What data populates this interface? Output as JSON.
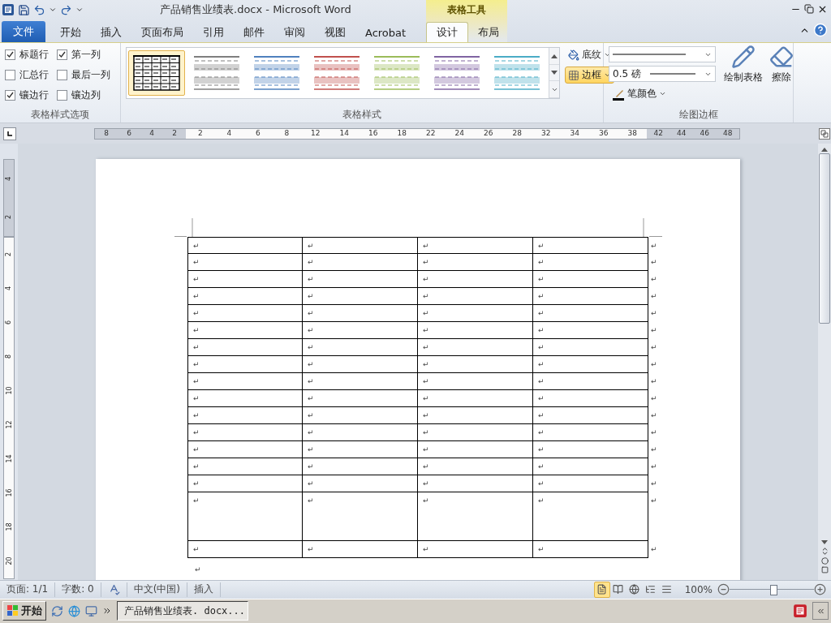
{
  "title_bar": {
    "title": "产品销售业绩表.docx  -  Microsoft Word"
  },
  "tabs": [
    {
      "label": "文件",
      "kind": "file",
      "selected": false
    },
    {
      "label": "开始",
      "kind": "plain",
      "selected": false
    },
    {
      "label": "插入",
      "kind": "plain",
      "selected": false
    },
    {
      "label": "页面布局",
      "kind": "plain",
      "selected": false
    },
    {
      "label": "引用",
      "kind": "plain",
      "selected": false
    },
    {
      "label": "邮件",
      "kind": "plain",
      "selected": false
    },
    {
      "label": "审阅",
      "kind": "plain",
      "selected": false
    },
    {
      "label": "视图",
      "kind": "plain",
      "selected": false
    },
    {
      "label": "Acrobat",
      "kind": "plain",
      "selected": false
    }
  ],
  "contextual_group": {
    "label": "表格工具",
    "tabs": [
      {
        "label": "设计",
        "selected": true
      },
      {
        "label": "布局",
        "selected": false
      }
    ]
  },
  "ribbon": {
    "style_options": {
      "label": "表格样式选项",
      "options": [
        {
          "label": "标题行",
          "checked": true
        },
        {
          "label": "第一列",
          "checked": true
        },
        {
          "label": "汇总行",
          "checked": false
        },
        {
          "label": "最后一列",
          "checked": false
        },
        {
          "label": "镶边行",
          "checked": true
        },
        {
          "label": "镶边列",
          "checked": false
        }
      ]
    },
    "table_styles": {
      "label": "表格样式",
      "styles": [
        {
          "kind": "grid",
          "color": "#000000",
          "selected": true
        },
        {
          "kind": "banded",
          "color": "#7f7f7f",
          "selected": false
        },
        {
          "kind": "banded",
          "color": "#4f81bd",
          "selected": false
        },
        {
          "kind": "banded",
          "color": "#c0504d",
          "selected": false
        },
        {
          "kind": "banded",
          "color": "#9bbb59",
          "selected": false
        },
        {
          "kind": "banded",
          "color": "#8064a2",
          "selected": false
        },
        {
          "kind": "banded",
          "color": "#4bacc6",
          "selected": false
        }
      ],
      "shading": "底纹",
      "borders": {
        "label": "边框",
        "selected": true
      }
    },
    "draw_borders": {
      "label": "绘图边框",
      "line_weight": "0.5 磅",
      "pen_color": "笔颜色",
      "draw_table": "绘制表格",
      "eraser": "擦除"
    }
  },
  "horizontal_ruler": [
    {
      "kind": "margin",
      "labels": [
        "8",
        "6",
        "4",
        "2"
      ]
    },
    {
      "kind": "column",
      "labels": [
        "2",
        "4",
        "6",
        "8"
      ]
    },
    {
      "kind": "column",
      "labels": [
        "12",
        "14",
        "16",
        "18"
      ]
    },
    {
      "kind": "column",
      "labels": [
        "22",
        "24",
        "26",
        "28"
      ]
    },
    {
      "kind": "column",
      "labels": [
        "32",
        "34",
        "36",
        "38"
      ]
    },
    {
      "kind": "margin",
      "labels": [
        "42",
        "44",
        "46",
        "48"
      ]
    }
  ],
  "vertical_ruler": [
    {
      "kind": "margin",
      "labels": [
        "4",
        "2"
      ]
    },
    {
      "kind": "column",
      "labels": [
        "2",
        "4",
        "6",
        "8",
        "10",
        "12",
        "14",
        "16",
        "18",
        "20"
      ]
    }
  ],
  "table": {
    "rows": [
      {
        "kind": "normal",
        "cells": [
          "↵",
          "↵",
          "↵",
          "↵"
        ],
        "end_mark": "↵"
      },
      {
        "kind": "normal",
        "cells": [
          "↵",
          "↵",
          "↵",
          "↵"
        ],
        "end_mark": "↵"
      },
      {
        "kind": "normal",
        "cells": [
          "↵",
          "↵",
          "↵",
          "↵"
        ],
        "end_mark": "↵"
      },
      {
        "kind": "normal",
        "cells": [
          "↵",
          "↵",
          "↵",
          "↵"
        ],
        "end_mark": "↵"
      },
      {
        "kind": "normal",
        "cells": [
          "↵",
          "↵",
          "↵",
          "↵"
        ],
        "end_mark": "↵"
      },
      {
        "kind": "normal",
        "cells": [
          "↵",
          "↵",
          "↵",
          "↵"
        ],
        "end_mark": "↵"
      },
      {
        "kind": "normal",
        "cells": [
          "↵",
          "↵",
          "↵",
          "↵"
        ],
        "end_mark": "↵"
      },
      {
        "kind": "normal",
        "cells": [
          "↵",
          "↵",
          "↵",
          "↵"
        ],
        "end_mark": "↵"
      },
      {
        "kind": "normal",
        "cells": [
          "↵",
          "↵",
          "↵",
          "↵"
        ],
        "end_mark": "↵"
      },
      {
        "kind": "normal",
        "cells": [
          "↵",
          "↵",
          "↵",
          "↵"
        ],
        "end_mark": "↵"
      },
      {
        "kind": "normal",
        "cells": [
          "↵",
          "↵",
          "↵",
          "↵"
        ],
        "end_mark": "↵"
      },
      {
        "kind": "normal",
        "cells": [
          "↵",
          "↵",
          "↵",
          "↵"
        ],
        "end_mark": "↵"
      },
      {
        "kind": "normal",
        "cells": [
          "↵",
          "↵",
          "↵",
          "↵"
        ],
        "end_mark": "↵"
      },
      {
        "kind": "normal",
        "cells": [
          "↵",
          "↵",
          "↵",
          "↵"
        ],
        "end_mark": "↵"
      },
      {
        "kind": "normal",
        "cells": [
          "↵",
          "↵",
          "↵",
          "↵"
        ],
        "end_mark": "↵"
      },
      {
        "kind": "tall",
        "cells": [
          "↵",
          "↵",
          "↵",
          "↵"
        ],
        "end_mark": "↵"
      },
      {
        "kind": "normal",
        "cells": [
          "↵",
          "↵",
          "↵",
          "↵"
        ],
        "end_mark": "↵"
      }
    ],
    "after_mark": "↵"
  },
  "status_bar": {
    "page": "页面: 1/1",
    "words": "字数: 0",
    "language": "中文(中国)",
    "mode": "插入",
    "views": [
      {
        "selected": true
      },
      {
        "selected": false
      },
      {
        "selected": false
      },
      {
        "selected": false
      },
      {
        "selected": false
      }
    ],
    "zoom": "100%",
    "zoom_slider": {
      "level": 0.52
    }
  },
  "taskbar": {
    "start": "开始",
    "window": "产品销售业绩表. docx..."
  }
}
